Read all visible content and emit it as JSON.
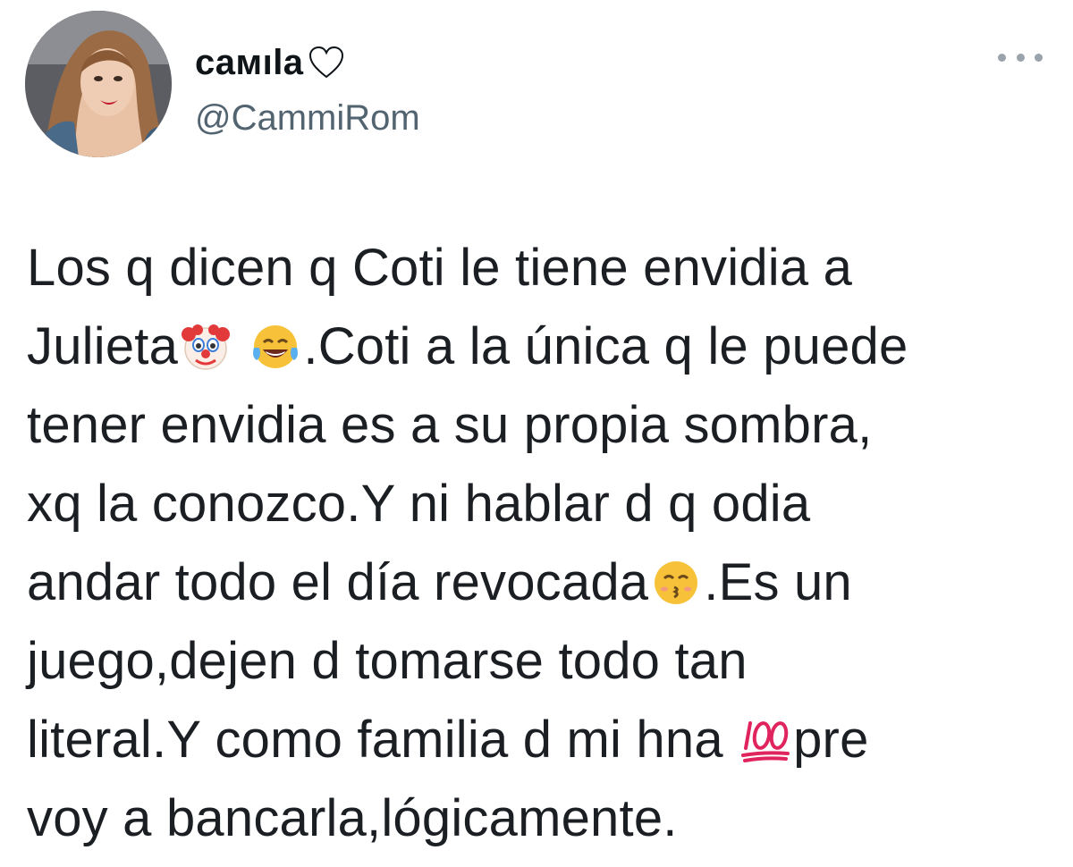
{
  "author": {
    "display_name": "cамıla",
    "handle": "@CammiRom",
    "avatar_icon": "profile-photo-icon",
    "name_suffix_icon": "white-heart-icon"
  },
  "menu": {
    "icon": "more-options-icon"
  },
  "tweet": {
    "lines": [
      "Los q dicen q Coti le tiene envidia a",
      "Julieta",
      ".Coti a la única q le puede",
      "tener envidia es a su propia sombra,",
      "xq la conozco.Y ni hablar d q odia",
      "andar todo el día revocada",
      ".Es un",
      "juego,dejen d tomarse todo tan",
      "literal.Y como familia d mi hna ",
      "pre",
      "voy a bancarla,lógicamente."
    ],
    "emoji_icons": [
      "clown-face-icon",
      "tears-of-joy-icon",
      "kissing-face-icon",
      "hundred-points-icon"
    ]
  },
  "colors": {
    "text": "#1b1f23",
    "handle": "#536471",
    "hundred_red": "#e0245e",
    "emoji_yellow": "#f7c23a"
  }
}
